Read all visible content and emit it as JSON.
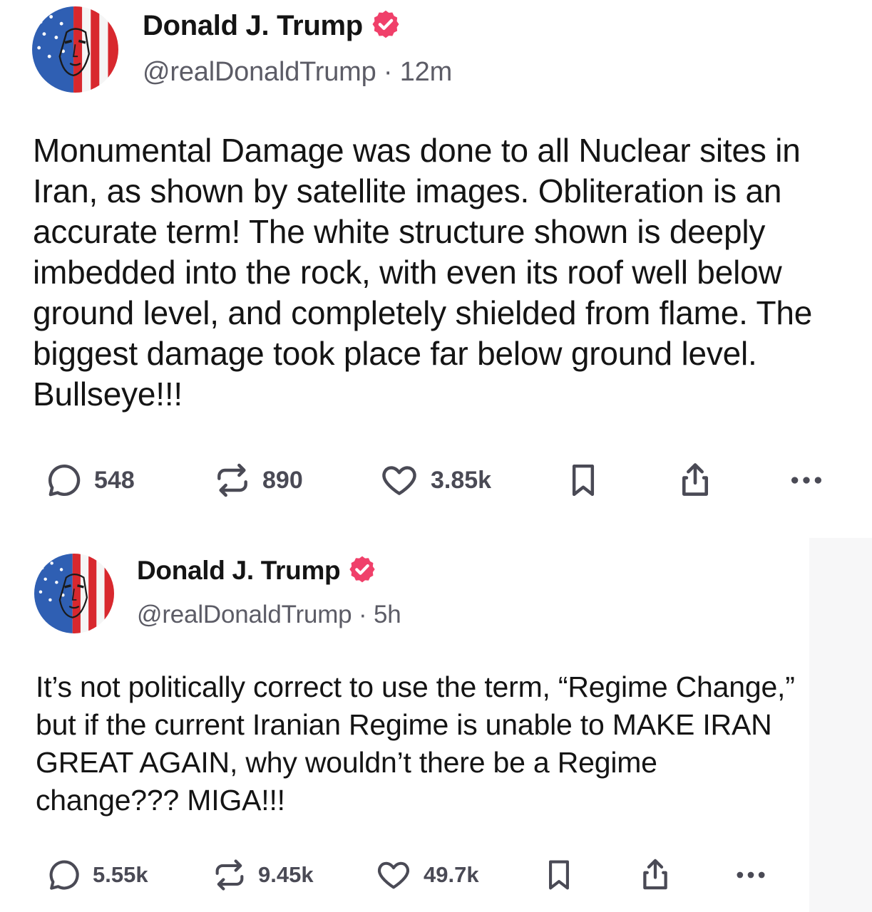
{
  "posts": [
    {
      "author": {
        "name": "Donald J. Trump",
        "handle": "@realDonaldTrump",
        "time": "12m",
        "verified": true,
        "avatar_icon": "flag-face-avatar"
      },
      "text": "Monumental Damage was done to all Nuclear sites in Iran, as shown by satellite images. Obliteration is an accurate term! The white structure shown is deeply imbedded into the rock, with even its roof well below ground level, and completely shielded from flame. The biggest damage took place far below ground level. Bullseye!!!",
      "actions": {
        "replies": "548",
        "reposts": "890",
        "likes": "3.85k",
        "icons": [
          "reply-icon",
          "repost-icon",
          "like-icon",
          "bookmark-icon",
          "share-icon",
          "more-icon"
        ]
      }
    },
    {
      "author": {
        "name": "Donald J. Trump",
        "handle": "@realDonaldTrump",
        "time": "5h",
        "verified": true,
        "avatar_icon": "flag-face-avatar"
      },
      "text": "It’s not politically correct to use the term, “Regime Change,” but if the current Iranian Regime is unable to MAKE IRAN GREAT AGAIN, why wouldn’t there be a Regime change??? MIGA!!!",
      "actions": {
        "replies": "5.55k",
        "reposts": "9.45k",
        "likes": "49.7k",
        "icons": [
          "reply-icon",
          "repost-icon",
          "like-icon",
          "bookmark-icon",
          "share-icon",
          "more-icon"
        ]
      }
    }
  ],
  "meta_ui": {
    "separator": "·"
  },
  "colors": {
    "verified_badge": "#f0406a",
    "text_primary": "#141414",
    "text_secondary": "#5c5c66",
    "action_gray": "#4a4a55"
  }
}
